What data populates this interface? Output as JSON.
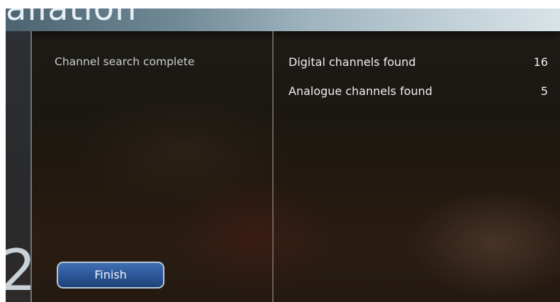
{
  "header": {
    "title": "allation"
  },
  "step": {
    "number": "2"
  },
  "status": {
    "text": "Channel search complete"
  },
  "results": [
    {
      "label": "Digital channels found",
      "value": "16"
    },
    {
      "label": "Analogue channels found",
      "value": "5"
    }
  ],
  "actions": {
    "finish_label": "Finish"
  },
  "colors": {
    "header": "#9fb4bf",
    "background": "#1d1813",
    "button": "#2b5595",
    "button_border": "#b9c9d9",
    "text": "#eef0f0"
  }
}
